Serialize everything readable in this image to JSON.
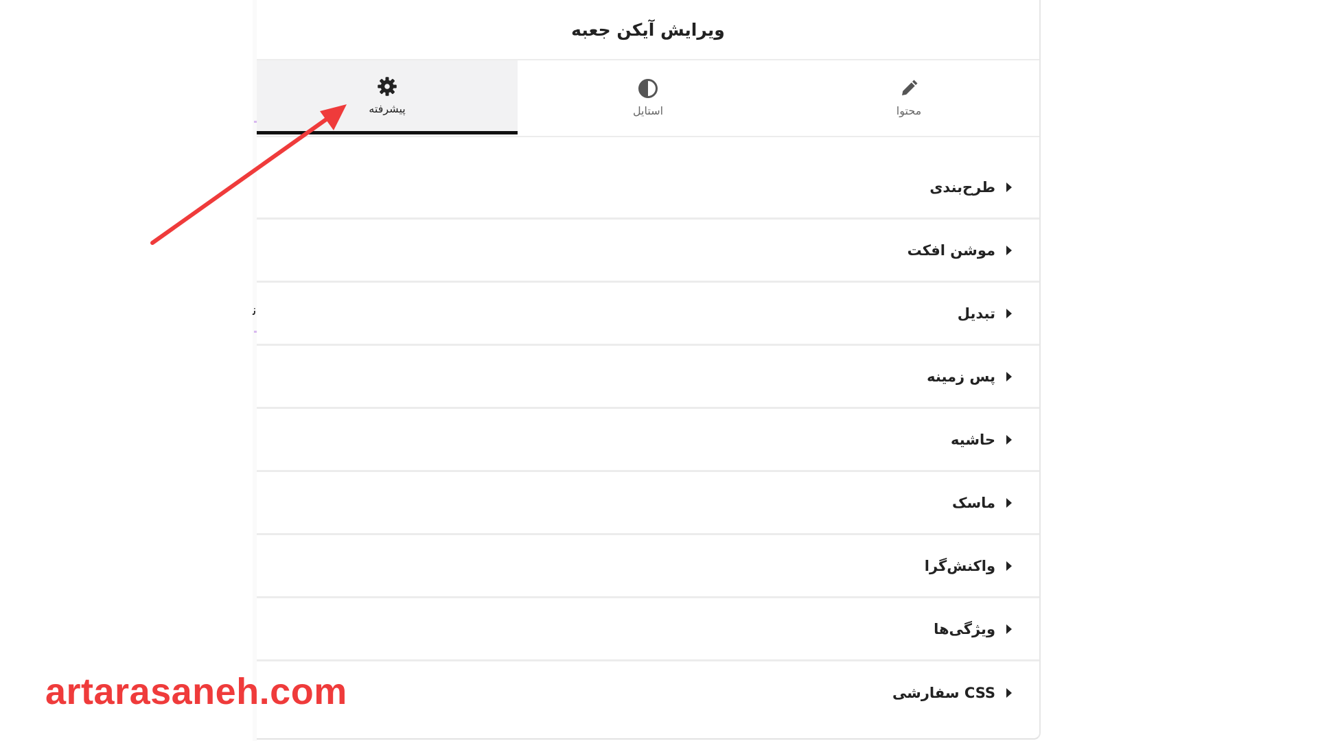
{
  "panel": {
    "title": "ویرایش آیکن جعبه"
  },
  "tabs": [
    {
      "label": "محتوا",
      "icon": "pencil-icon",
      "active": false
    },
    {
      "label": "استایل",
      "icon": "half-circle-icon",
      "active": false
    },
    {
      "label": "پیشرفته",
      "icon": "gear-icon",
      "active": true
    }
  ],
  "sections": [
    {
      "label": "طرح‌بندی"
    },
    {
      "label": "موشن افکت"
    },
    {
      "label": "تبدیل"
    },
    {
      "label": "پس زمینه"
    },
    {
      "label": "حاشیه"
    },
    {
      "label": "ماسک"
    },
    {
      "label": "واکنش‌گرا"
    },
    {
      "label": "ویژگی‌ها"
    },
    {
      "label": "CSS سفارشی"
    }
  ],
  "watermark": "artarasaneh.com",
  "colors": {
    "annotation_arrow": "#ef3b3b",
    "active_tab_underline": "#111111"
  }
}
